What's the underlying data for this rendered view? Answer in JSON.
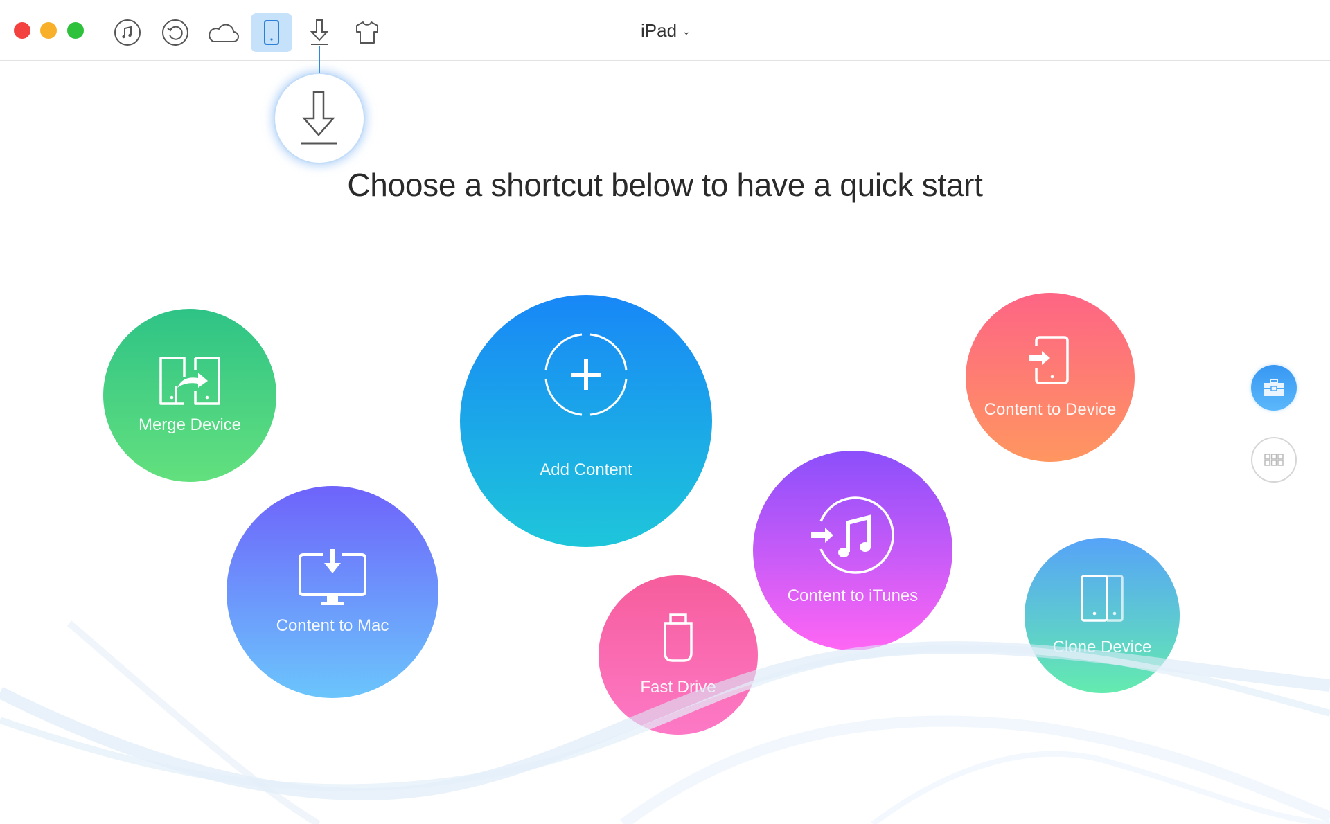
{
  "window": {
    "traffic_lights": [
      "close",
      "minimize",
      "zoom"
    ],
    "device_selector": {
      "label": "iPad",
      "icon": "chevron-down-icon"
    }
  },
  "toolbar": {
    "items": [
      {
        "name": "music",
        "icon": "music-note-icon",
        "selected": false
      },
      {
        "name": "backup-restore",
        "icon": "restore-icon",
        "selected": false
      },
      {
        "name": "icloud",
        "icon": "cloud-icon",
        "selected": false
      },
      {
        "name": "device",
        "icon": "tablet-icon",
        "selected": true
      },
      {
        "name": "download",
        "icon": "download-icon",
        "selected": false
      },
      {
        "name": "theme",
        "icon": "tshirt-icon",
        "selected": false
      }
    ],
    "accent": "#2c87de",
    "selected_bg": "#c6e2fa"
  },
  "main": {
    "headline": "Choose a shortcut below to have a quick start",
    "shortcuts": [
      {
        "label": "Merge Device",
        "icon": "merge-device-icon",
        "colors": [
          "#2ec386",
          "#63e07e"
        ]
      },
      {
        "label": "Add Content",
        "icon": "add-content-icon",
        "colors": [
          "#1887f7",
          "#1ec6da"
        ]
      },
      {
        "label": "Content to Mac",
        "icon": "monitor-download-icon",
        "colors": [
          "#6e63fb",
          "#6bc5fc"
        ]
      },
      {
        "label": "Fast Drive",
        "icon": "usb-drive-icon",
        "colors": [
          "#f65d9c",
          "#fd79c6"
        ]
      },
      {
        "label": "Content to iTunes",
        "icon": "itunes-import-icon",
        "colors": [
          "#8b4ffb",
          "#ff66f4"
        ]
      },
      {
        "label": "Content to Device",
        "icon": "device-import-icon",
        "colors": [
          "#fe6585",
          "#ff9660"
        ]
      },
      {
        "label": "Clone Device",
        "icon": "clone-device-icon",
        "colors": [
          "#56a3f8",
          "#64ebaf"
        ]
      }
    ]
  },
  "side": {
    "tools_button": {
      "icon": "toolbox-icon",
      "active": true
    },
    "grid_button": {
      "icon": "grid-icon",
      "active": false
    }
  }
}
